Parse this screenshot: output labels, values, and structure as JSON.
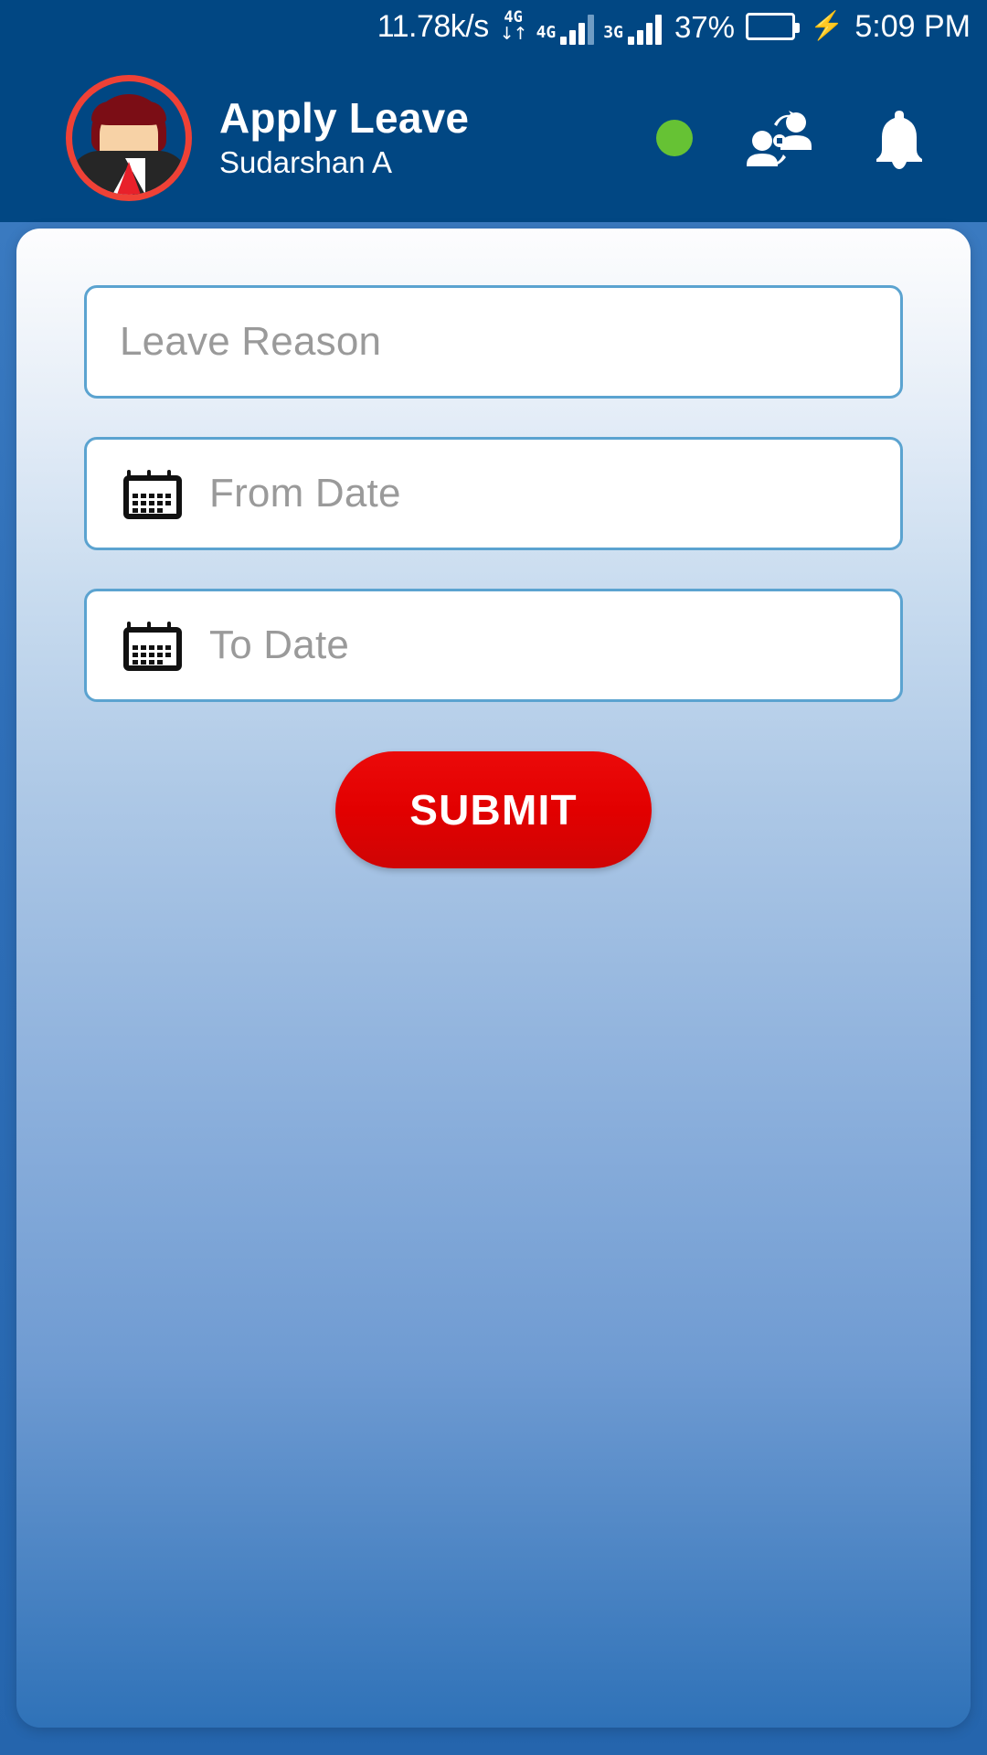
{
  "status_bar": {
    "network_speed": "11.78k/s",
    "data_transfer_label": "4G",
    "data_transfer_arrows": "↓↑",
    "sim1_label": "4G",
    "sim2_label": "3G",
    "battery_percent": "37%",
    "battery_level": 37,
    "charging": true,
    "charging_icon": "bolt-icon",
    "time": "5:09 PM"
  },
  "app_bar": {
    "title": "Apply Leave",
    "subtitle": "Sudarshan A",
    "avatar_name": "user-avatar",
    "status_dot_color": "#66c234",
    "actions": [
      {
        "name": "online-status-dot",
        "label": ""
      },
      {
        "name": "switch-user-icon",
        "label": ""
      },
      {
        "name": "notification-bell-icon",
        "label": ""
      }
    ]
  },
  "form": {
    "leave_reason": {
      "placeholder": "Leave Reason",
      "value": ""
    },
    "from_date": {
      "icon": "calendar-icon",
      "placeholder": "From Date",
      "value": ""
    },
    "to_date": {
      "icon": "calendar-icon",
      "placeholder": "To Date",
      "value": ""
    },
    "submit_label": "SUBMIT"
  },
  "colors": {
    "app_bar": "#014783",
    "status_bar": "#014783",
    "field_border": "#5ba3d0",
    "submit_red": "#e20000",
    "avatar_ring": "#ef4136",
    "placeholder_grey": "#9a9a9a"
  }
}
